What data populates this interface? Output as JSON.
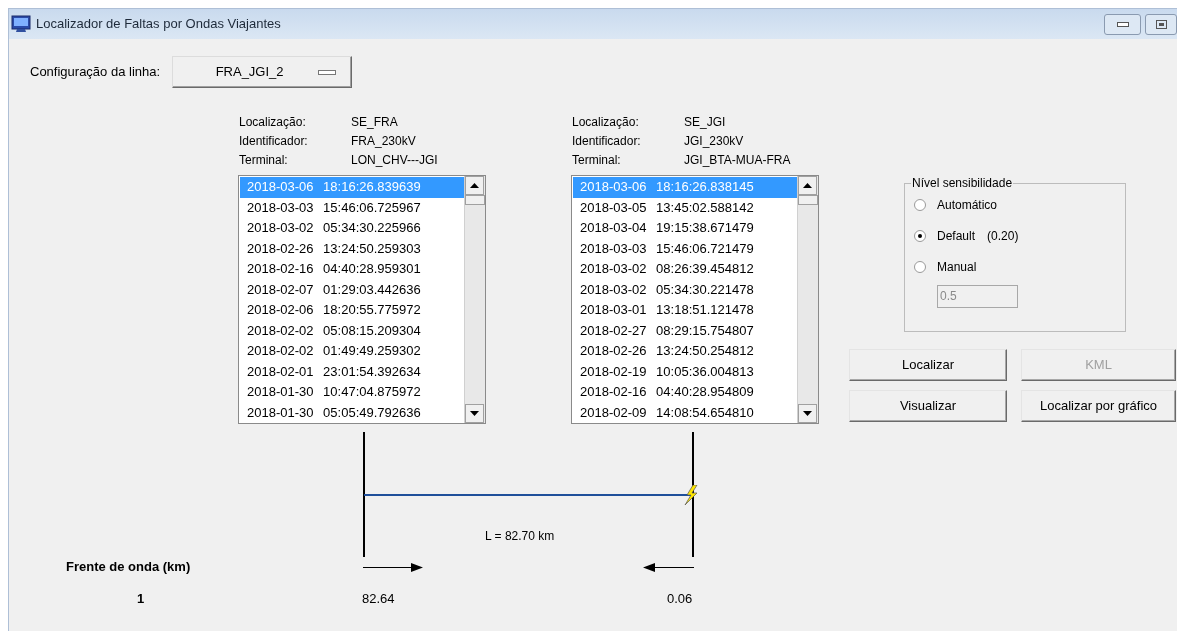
{
  "window": {
    "title": "Localizador de Faltas por Ondas Viajantes"
  },
  "line_config": {
    "label": "Configuração da linha:",
    "value": "FRA_JGI_2"
  },
  "terminals": [
    {
      "fields": [
        {
          "label": "Localização:",
          "value": "SE_FRA"
        },
        {
          "label": "Identificador:",
          "value": "FRA_230kV"
        },
        {
          "label": "Terminal:",
          "value": "LON_CHV---JGI"
        }
      ],
      "events": [
        {
          "text": "2018-03-06 18:16:26.839639",
          "selected": true
        },
        {
          "text": "2018-03-03 15:46:06.725967",
          "selected": false
        },
        {
          "text": "2018-03-02 05:34:30.225966",
          "selected": false
        },
        {
          "text": "2018-02-26 13:24:50.259303",
          "selected": false
        },
        {
          "text": "2018-02-16 04:40:28.959301",
          "selected": false
        },
        {
          "text": "2018-02-07 01:29:03.442636",
          "selected": false
        },
        {
          "text": "2018-02-06 18:20:55.775972",
          "selected": false
        },
        {
          "text": "2018-02-02 05:08:15.209304",
          "selected": false
        },
        {
          "text": "2018-02-02 01:49:49.259302",
          "selected": false
        },
        {
          "text": "2018-02-01 23:01:54.392634",
          "selected": false
        },
        {
          "text": "2018-01-30 10:47:04.875972",
          "selected": false
        },
        {
          "text": "2018-01-30 05:05:49.792636",
          "selected": false
        }
      ]
    },
    {
      "fields": [
        {
          "label": "Localização:",
          "value": "SE_JGI"
        },
        {
          "label": "Identificador:",
          "value": "JGI_230kV"
        },
        {
          "label": "Terminal:",
          "value": "JGI_BTA-MUA-FRA"
        }
      ],
      "events": [
        {
          "text": "2018-03-06 18:16:26.838145",
          "selected": true
        },
        {
          "text": "2018-03-05 13:45:02.588142",
          "selected": false
        },
        {
          "text": "2018-03-04 19:15:38.671479",
          "selected": false
        },
        {
          "text": "2018-03-03 15:46:06.721479",
          "selected": false
        },
        {
          "text": "2018-03-02 08:26:39.454812",
          "selected": false
        },
        {
          "text": "2018-03-02 05:34:30.221478",
          "selected": false
        },
        {
          "text": "2018-03-01 13:18:51.121478",
          "selected": false
        },
        {
          "text": "2018-02-27 08:29:15.754807",
          "selected": false
        },
        {
          "text": "2018-02-26 13:24:50.254812",
          "selected": false
        },
        {
          "text": "2018-02-19 10:05:36.004813",
          "selected": false
        },
        {
          "text": "2018-02-16 04:40:28.954809",
          "selected": false
        },
        {
          "text": "2018-02-09 14:08:54.654810",
          "selected": false
        }
      ]
    }
  ],
  "sensitivity": {
    "title": "Nível sensibilidade",
    "options": [
      {
        "label": "Automático",
        "selected": false
      },
      {
        "label": "Default",
        "note": "(0.20)",
        "selected": true
      },
      {
        "label": "Manual",
        "selected": false
      }
    ],
    "manual_value": "0.5",
    "manual_disabled": true
  },
  "buttons": [
    {
      "label": "Localizar",
      "disabled": false
    },
    {
      "label": "KML",
      "disabled": true
    },
    {
      "label": "Visualizar",
      "disabled": false
    },
    {
      "label": "Localizar por gráfico",
      "disabled": false
    }
  ],
  "diagram": {
    "length_label": "L = 82.70 km",
    "left_distance": "82.64",
    "right_distance": "0.06"
  },
  "wavefront": {
    "header": "Frente de onda (km)",
    "index": "1"
  }
}
